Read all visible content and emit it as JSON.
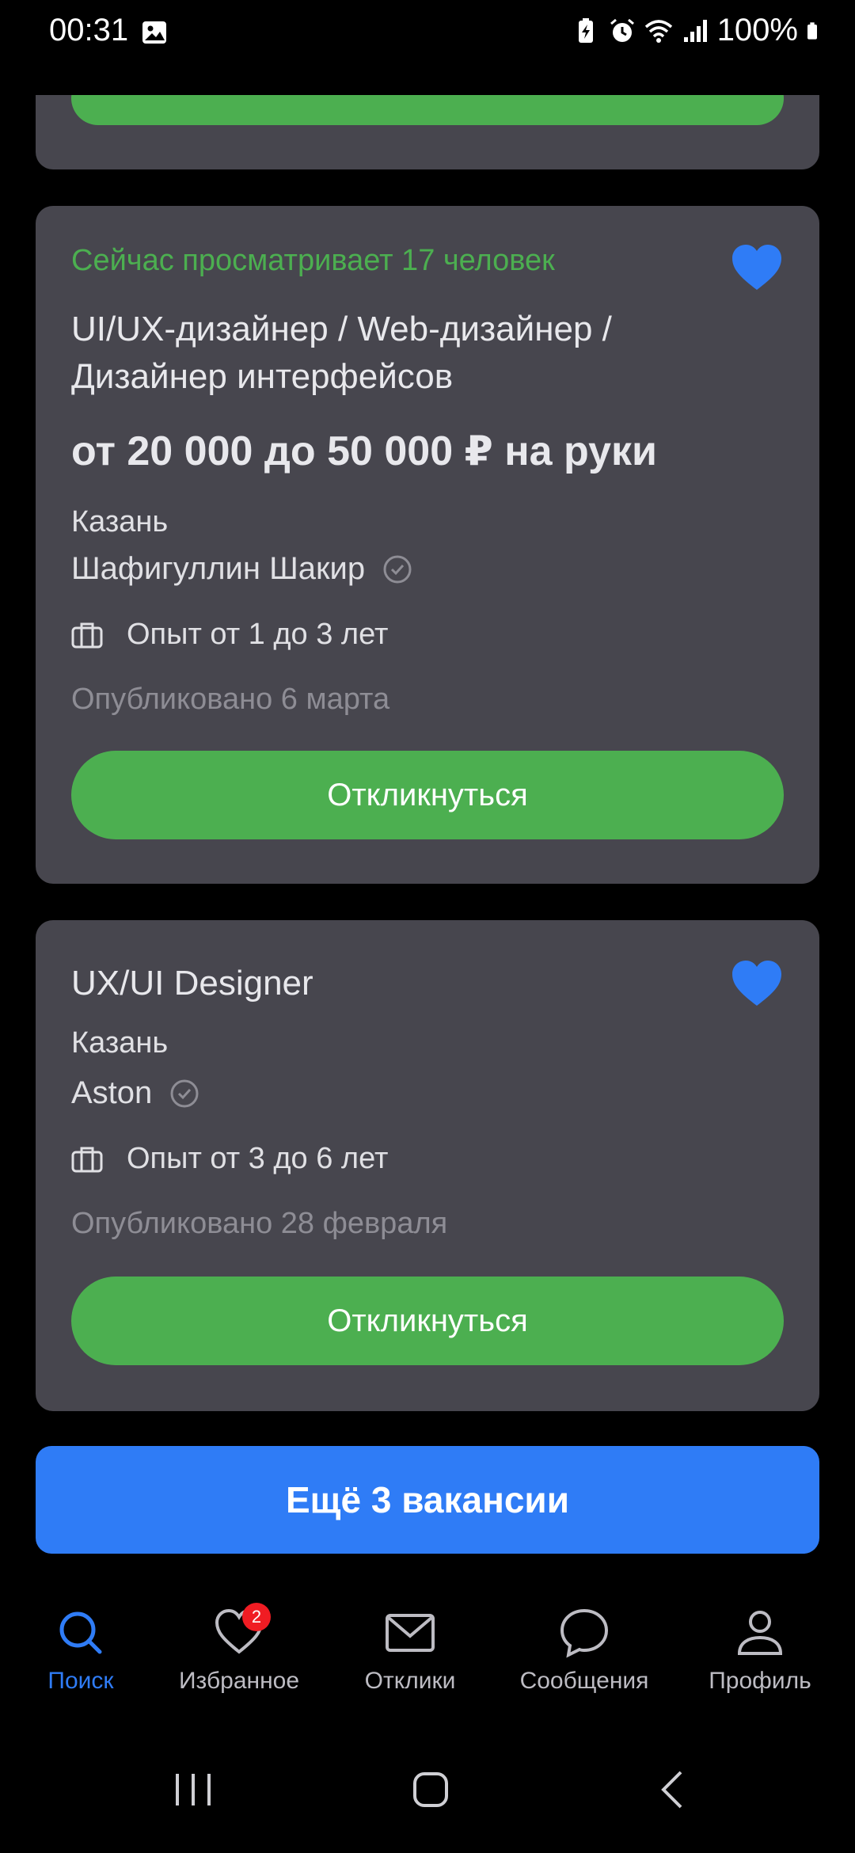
{
  "status_bar": {
    "time": "00:31",
    "battery": "100%",
    "icons": [
      "photo-icon",
      "battery-saver-icon",
      "alarm-icon",
      "wifi-icon",
      "signal-icon",
      "battery-icon"
    ]
  },
  "vacancies": [
    {
      "viewers": "Сейчас просматривает 17 человек",
      "title": "UI/UX-дизайнер / Web-дизайнер / Дизайнер интерфейсов",
      "salary": "от 20 000 до 50 000 ₽ на руки",
      "city": "Казань",
      "company": "Шафигуллин Шакир",
      "experience": "Опыт от 1 до 3 лет",
      "published": "Опубликовано 6 марта",
      "apply_label": "Откликнуться",
      "favorited": true
    },
    {
      "title": "UX/UI Designer",
      "city": "Казань",
      "company": "Aston",
      "experience": "Опыт от 3 до 6 лет",
      "published": "Опубликовано 28 февраля",
      "apply_label": "Откликнуться",
      "favorited": true
    }
  ],
  "more_button": "Ещё 3 вакансии",
  "bottom_nav": [
    {
      "label": "Поиск",
      "icon": "search-icon",
      "active": true
    },
    {
      "label": "Избранное",
      "icon": "heart-icon",
      "badge": "2"
    },
    {
      "label": "Отклики",
      "icon": "envelope-icon"
    },
    {
      "label": "Сообщения",
      "icon": "chat-bubble-icon"
    },
    {
      "label": "Профиль",
      "icon": "person-icon"
    }
  ],
  "colors": {
    "accent_green": "#4caf50",
    "accent_blue": "#2f7cf6",
    "card_bg": "#47464e",
    "badge_red": "#f01c23"
  }
}
